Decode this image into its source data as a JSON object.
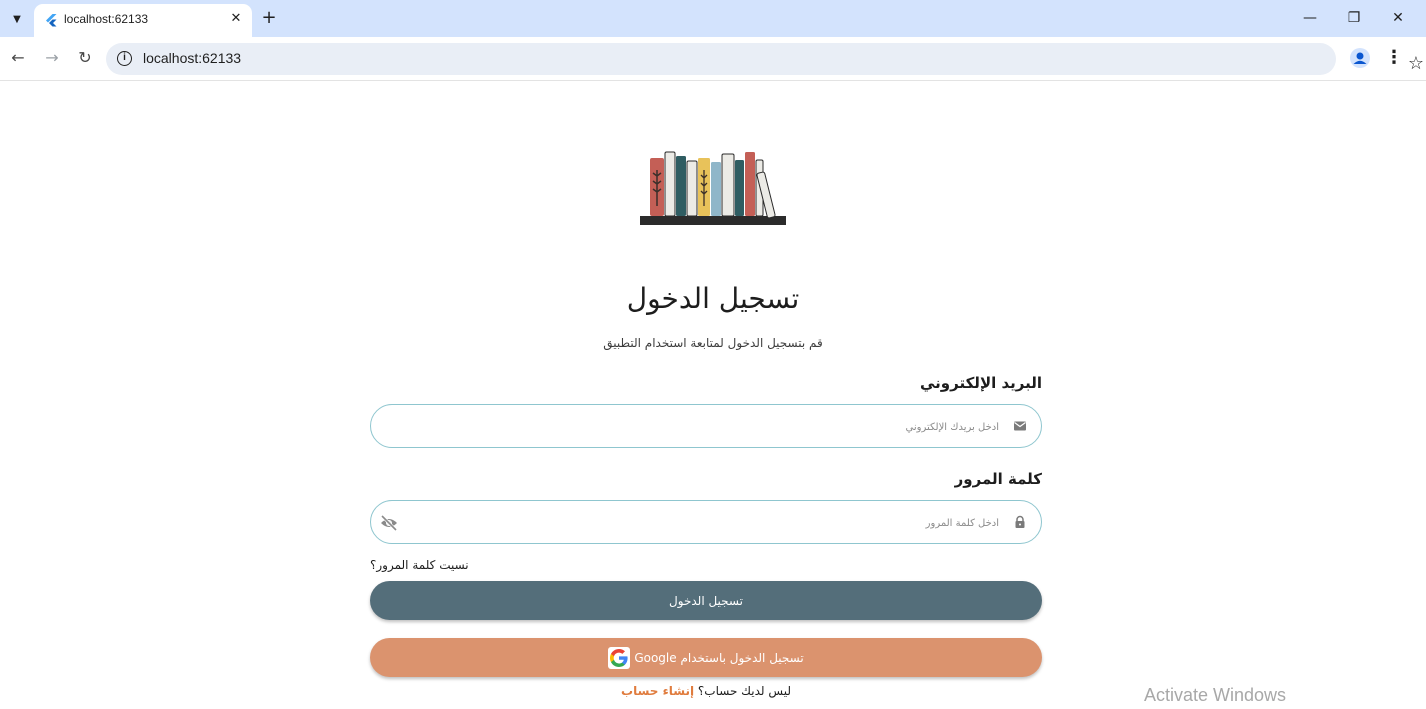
{
  "browser": {
    "tab_title": "localhost:62133",
    "tab_close": "✕",
    "new_tab": "+",
    "url": "localhost:62133",
    "window_controls": {
      "minimize": "—",
      "restore": "❐",
      "close": "✕"
    },
    "icons": [
      "tab-search-icon",
      "flutter-icon",
      "back-icon",
      "forward-icon",
      "reload-icon",
      "info-icon",
      "star-icon",
      "profile-icon",
      "menu-icon"
    ]
  },
  "page": {
    "logo": "bookshelf-logo",
    "title": "تسجيل الدخول",
    "subtitle": "قم بتسجيل الدخول لمتابعة استخدام التطبيق",
    "email": {
      "label": "البريد الإلكتروني",
      "placeholder": "أدخل بريدك الإلكتروني",
      "value": ""
    },
    "password": {
      "label": "كلمة المرور",
      "placeholder": "أدخل كلمة المرور",
      "value": ""
    },
    "forgot_password": "نسيت كلمة المرور؟",
    "login_button": "تسجيل الدخول",
    "google_button": "تسجيل الدخول باستخدام Google",
    "signup_prompt": "ليس لديك حساب؟",
    "signup_link": "إنشاء حساب"
  },
  "overlay": {
    "watermark": "Activate Windows"
  },
  "colors": {
    "primary_button": "#546e7a",
    "google_button": "#db936e",
    "input_border": "#8fc6cf",
    "link": "#e07c3e",
    "tabstrip": "#d3e3fd"
  }
}
